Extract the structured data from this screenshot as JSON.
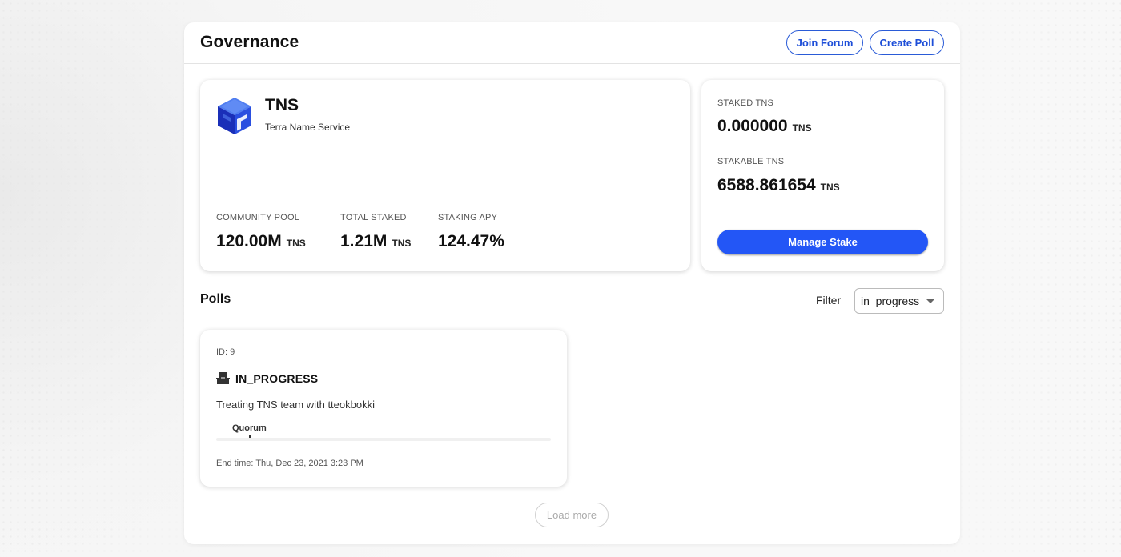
{
  "header": {
    "title": "Governance",
    "join_forum_label": "Join Forum",
    "create_poll_label": "Create Poll"
  },
  "token": {
    "symbol": "TNS",
    "name": "Terra Name Service",
    "logo_icon": "tns-cube-logo",
    "stats": [
      {
        "label": "COMMUNITY POOL",
        "value": "120.00M",
        "unit": "TNS"
      },
      {
        "label": "TOTAL STAKED",
        "value": "1.21M",
        "unit": "TNS"
      },
      {
        "label": "STAKING APY",
        "value": "124.47%",
        "unit": ""
      }
    ]
  },
  "staking": {
    "staked_label": "STAKED TNS",
    "staked_value": "0.000000",
    "staked_unit": "TNS",
    "stakable_label": "STAKABLE TNS",
    "stakable_value": "6588.861654",
    "stakable_unit": "TNS",
    "manage_label": "Manage Stake"
  },
  "polls": {
    "title": "Polls",
    "filter_label": "Filter",
    "filter_value": "in_progress",
    "items": [
      {
        "id": "ID: 9",
        "status": "IN_PROGRESS",
        "status_icon": "ballot-box-icon",
        "title": "Treating TNS team with tteokbokki",
        "quorum_label": "Quorum",
        "vote_progress": 0,
        "end_time": "End time: Thu, Dec 23, 2021 3:23 PM"
      }
    ],
    "load_more_label": "Load more"
  },
  "colors": {
    "accent": "#2356f6",
    "outline_accent": "#1d4ed8",
    "logo_blue": "#1f3fd1"
  }
}
